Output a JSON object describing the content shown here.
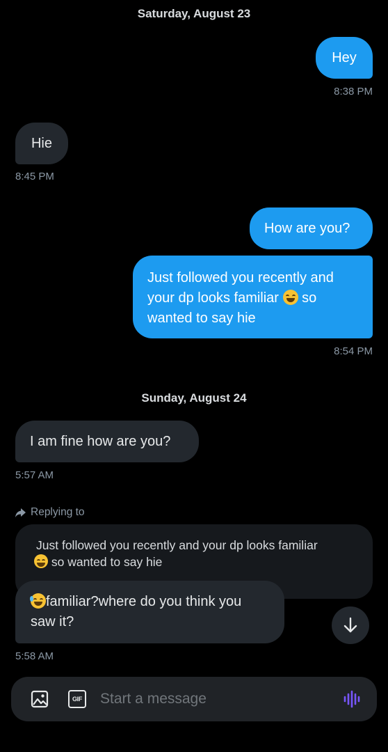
{
  "thread": {
    "date_1": "Saturday, August 23",
    "msg_hey": "Hey",
    "time_hey": "8:38 PM",
    "msg_hie": "Hie",
    "time_hie": "8:45 PM",
    "msg_how": "How are you?",
    "msg_follow_line1": "Just followed you recently and",
    "msg_follow_line2a": "your dp looks familiar",
    "msg_follow_line2b": "so",
    "msg_follow_line3": "wanted to say hie",
    "time_follow": "8:54 PM",
    "date_2": "Sunday, August 24",
    "msg_fine": "I am fine how are you?",
    "time_fine": "5:57 AM",
    "replying_label": "Replying to",
    "quote_line1": "Just followed you recently and your dp looks familiar",
    "quote_line2": "so wanted to say hie",
    "reply_line1": "familiar?where do you think you",
    "reply_line2": "saw it?",
    "time_reply": "5:58 AM"
  },
  "composer": {
    "placeholder": "Start a message",
    "gif_label": "GIF",
    "icons": [
      "image-icon",
      "gif-icon",
      "voice-icon"
    ]
  },
  "colors": {
    "outgoing": "#1d9bf0",
    "incoming": "#23282e",
    "voice_accent": "#7856ff"
  }
}
